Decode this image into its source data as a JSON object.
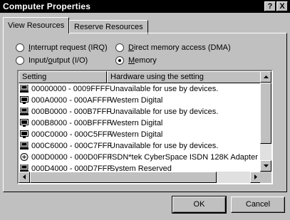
{
  "window": {
    "title": "Computer Properties",
    "help_label": "?",
    "close_label": "X"
  },
  "tabs": [
    {
      "label": "View Resources",
      "active": true
    },
    {
      "label": "Reserve Resources",
      "active": false
    }
  ],
  "radios": [
    {
      "label_pre": "",
      "label_u": "I",
      "label_post": "nterrupt request (IRQ)",
      "checked": false
    },
    {
      "label_pre": "Input/",
      "label_u": "o",
      "label_post": "utput (I/O)",
      "checked": false
    },
    {
      "label_pre": "",
      "label_u": "D",
      "label_post": "irect memory access (DMA)",
      "checked": false
    },
    {
      "label_pre": "",
      "label_u": "M",
      "label_post": "emory",
      "checked": true
    }
  ],
  "list": {
    "columns": [
      "Setting",
      "Hardware using the setting"
    ],
    "rows": [
      {
        "icon": "computer-icon",
        "setting": "00000000 - 0009FFFF",
        "hardware": "Unavailable for use by devices."
      },
      {
        "icon": "monitor-icon",
        "setting": "000A0000 - 000AFFFF",
        "hardware": "Western Digital"
      },
      {
        "icon": "computer-icon",
        "setting": "000B0000 - 000B7FFF",
        "hardware": "Unavailable for use by devices."
      },
      {
        "icon": "monitor-icon",
        "setting": "000B8000 - 000BFFFF",
        "hardware": "Western Digital"
      },
      {
        "icon": "monitor-icon",
        "setting": "000C0000 - 000C5FFF",
        "hardware": "Western Digital"
      },
      {
        "icon": "computer-icon",
        "setting": "000C6000 - 000C7FFF",
        "hardware": "Unavailable for use by devices."
      },
      {
        "icon": "isdn-adapter-icon",
        "setting": "000D0000 - 000D0FFF",
        "hardware": "ISDN*tek CyberSpace ISDN 128K Adapter"
      },
      {
        "icon": "computer-icon",
        "setting": "000D4000 - 000D7FFF",
        "hardware": "System Reserved"
      }
    ]
  },
  "buttons": {
    "ok": "OK",
    "cancel": "Cancel"
  }
}
